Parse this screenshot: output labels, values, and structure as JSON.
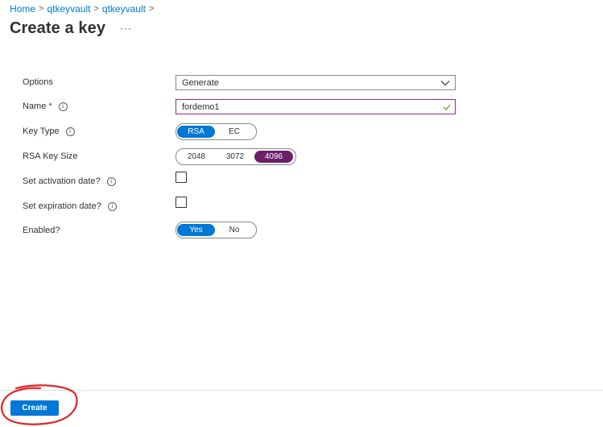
{
  "breadcrumb": {
    "items": [
      "Home",
      "qtkeyvault",
      "qtkeyvault"
    ],
    "separator": ">"
  },
  "header": {
    "title": "Create a key",
    "more_label": "···"
  },
  "form": {
    "options": {
      "label": "Options",
      "value": "Generate"
    },
    "name": {
      "label": "Name",
      "required_mark": "*",
      "value": "fordemo1"
    },
    "key_type": {
      "label": "Key Type",
      "options": [
        "RSA",
        "EC"
      ],
      "selected": "RSA"
    },
    "rsa_key_size": {
      "label": "RSA Key Size",
      "options": [
        "2048",
        "3072",
        "4096"
      ],
      "selected": "4096"
    },
    "activation": {
      "label": "Set activation date?",
      "checked": false
    },
    "expiration": {
      "label": "Set expiration date?",
      "checked": false
    },
    "enabled": {
      "label": "Enabled?",
      "options": [
        "Yes",
        "No"
      ],
      "selected": "Yes"
    }
  },
  "footer": {
    "create_label": "Create"
  },
  "colors": {
    "accent": "#0078d4",
    "selected_purple": "#6b1f6b",
    "annotation": "#e0262a",
    "valid_check": "#57a300"
  },
  "icons": {
    "info": "info-icon",
    "chevron": "chevron-down-icon",
    "valid": "checkmark-icon",
    "more": "more-icon"
  }
}
